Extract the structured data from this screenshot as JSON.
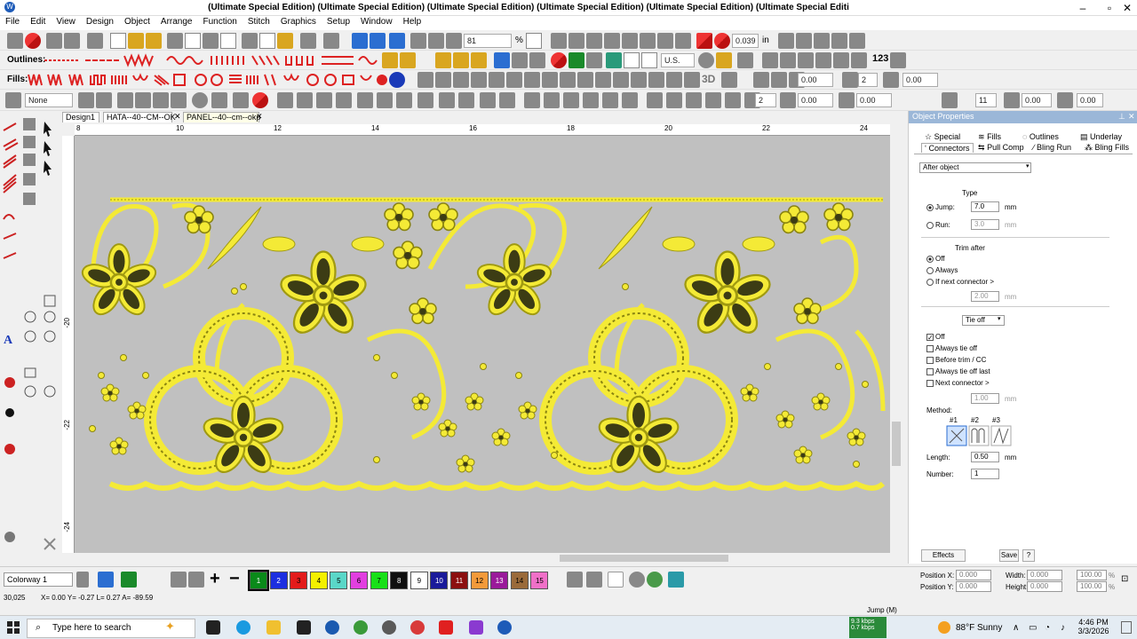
{
  "window": {
    "title": "(Ultimate Special Edition) (Ultimate Special Edition) (Ultimate Special Edition) (Ultimate Special Edition) (Ultimate Special Edition) (Ultimate Special Editi",
    "minimize": "–",
    "maximize": "▫",
    "close": "✕"
  },
  "menu": [
    "File",
    "Edit",
    "View",
    "Design",
    "Object",
    "Arrange",
    "Function",
    "Stitch",
    "Graphics",
    "Setup",
    "Window",
    "Help"
  ],
  "toolbar1": {
    "zoom_value": "81",
    "zoom_unit": "%",
    "grid_value": "0.039",
    "grid_unit": "in"
  },
  "toolbar2": {
    "outlines_label": "Outlines:",
    "unit_value": "U.S."
  },
  "toolbar3": {
    "fills_label": "Fills:"
  },
  "toolbar4": {
    "none_label": "None",
    "values": [
      "2",
      "0.00",
      "0.00",
      "11",
      "0.00",
      "0.00"
    ],
    "number_3d": "3D",
    "text_123": "123"
  },
  "doc_tabs": [
    "Design1",
    "HATA--40--CM--OK",
    "PANEL--40--cm--okp"
  ],
  "ruler_top": [
    "8",
    "10",
    "12",
    "14",
    "16",
    "18",
    "20",
    "22",
    "24"
  ],
  "ruler_left": [
    "-20",
    "-22",
    "-24"
  ],
  "panel": {
    "title": "Object Properties",
    "tabs_row1": [
      "Special",
      "Fills",
      "Outlines",
      "Underlay"
    ],
    "tabs_row2": [
      "Connectors",
      "Pull Comp",
      "Bling Run",
      "Bling Fills"
    ],
    "after_object": "After object",
    "type_label": "Type",
    "jump_label": "Jump:",
    "jump_value": "7.0",
    "run_label": "Run:",
    "run_value": "3.0",
    "mm": "mm",
    "trim_after_label": "Trim after",
    "trim_off": "Off",
    "trim_always": "Always",
    "trim_if_next": "If next connector >",
    "trim_value": "2.00",
    "tie_off_select": "Tie off",
    "tie_off": "Off",
    "always_tie_off": "Always tie off",
    "before_trim": "Before trim / CC",
    "always_tie_off_last": "Always tie off last",
    "next_connector": "Next connector >",
    "next_value": "1.00",
    "method_label": "Method:",
    "method_nums": [
      "#1",
      "#2",
      "#3"
    ],
    "length_label": "Length:",
    "length_value": "0.50",
    "number_label": "Number:",
    "number_value": "1",
    "effects": "Effects",
    "save": "Save",
    "help": "?"
  },
  "bottom": {
    "colorway": "Colorway 1",
    "swatches": [
      {
        "n": "1",
        "c": "#0a8a1a"
      },
      {
        "n": "2",
        "c": "#1c2fe0"
      },
      {
        "n": "3",
        "c": "#e31b1b"
      },
      {
        "n": "4",
        "c": "#f4f000"
      },
      {
        "n": "5",
        "c": "#5ad7c8"
      },
      {
        "n": "6",
        "c": "#e23fe0"
      },
      {
        "n": "7",
        "c": "#18e018"
      },
      {
        "n": "8",
        "c": "#101010"
      },
      {
        "n": "9",
        "c": "#ffffff"
      },
      {
        "n": "10",
        "c": "#1a1a9a"
      },
      {
        "n": "11",
        "c": "#8c1010"
      },
      {
        "n": "12",
        "c": "#f39a3a"
      },
      {
        "n": "13",
        "c": "#9a1a9a"
      },
      {
        "n": "14",
        "c": "#9a6a3a"
      },
      {
        "n": "15",
        "c": "#f070c8"
      }
    ],
    "pos_x_label": "Position X:",
    "pos_x": "0.000",
    "pos_y_label": "Position Y:",
    "pos_y": "0.000",
    "width_label": "Width:",
    "width": "0.000",
    "height_label": "Height:",
    "height": "0.000",
    "pct_w": "100.00",
    "pct_h": "100.00",
    "pct": "%"
  },
  "status": {
    "left": "30,025",
    "coords": "X=  0.00 Y=  -0.27 L=  0.27 A= -89.59",
    "jump": "Jump (M)"
  },
  "taskbar": {
    "search": "Type here to search",
    "net1": "9.3 kbps",
    "net2": "0.7 kbps",
    "weather": "88°F  Sunny",
    "time": "4:46 PM",
    "date": "3/3/2026"
  }
}
